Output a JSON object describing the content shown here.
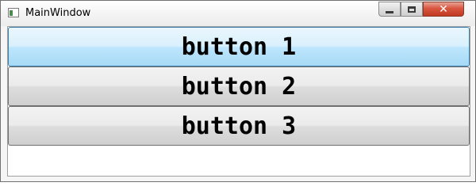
{
  "window": {
    "title": "MainWindow",
    "icons": {
      "app": "app-window-icon",
      "minimize": "minimize-icon",
      "maximize": "maximize-icon",
      "close": "close-icon"
    },
    "close_glyph": "✕"
  },
  "buttons": [
    {
      "label": "button 1",
      "state": "hover"
    },
    {
      "label": "button 2",
      "state": "normal"
    },
    {
      "label": "button 3",
      "state": "normal"
    }
  ],
  "colors": {
    "hover_accent": "#bee6fd",
    "close_red": "#c03a22"
  }
}
